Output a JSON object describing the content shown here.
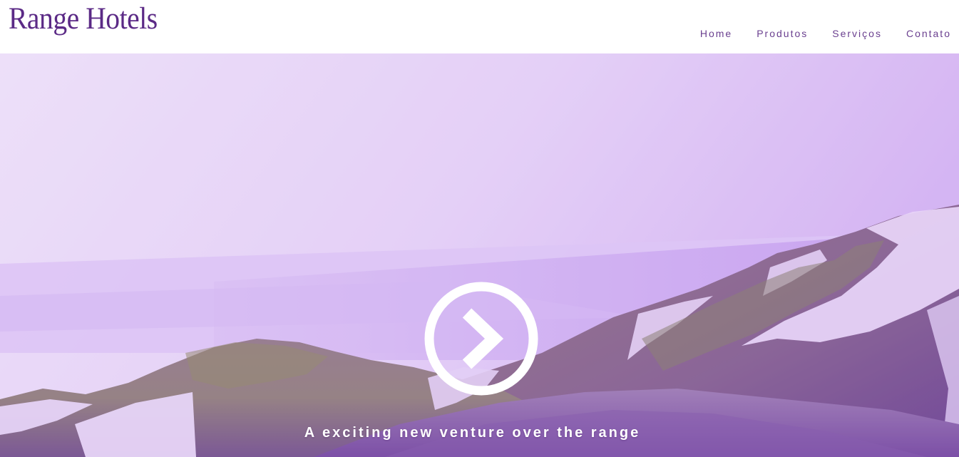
{
  "brand": {
    "logo_text": "Range Hotels"
  },
  "nav": {
    "items": [
      {
        "label": "Home"
      },
      {
        "label": "Produtos"
      },
      {
        "label": "Serviços"
      },
      {
        "label": "Contato"
      }
    ]
  },
  "hero": {
    "tagline": "A exciting new venture over the range",
    "play_icon": "chevron-right-circle-icon",
    "background": "purple-tinted snowy mountain landscape"
  },
  "colors": {
    "brand_purple": "#5b2a86",
    "nav_text": "#6a3f8f",
    "overlay_purple": "#c7a2f0",
    "white": "#ffffff"
  }
}
